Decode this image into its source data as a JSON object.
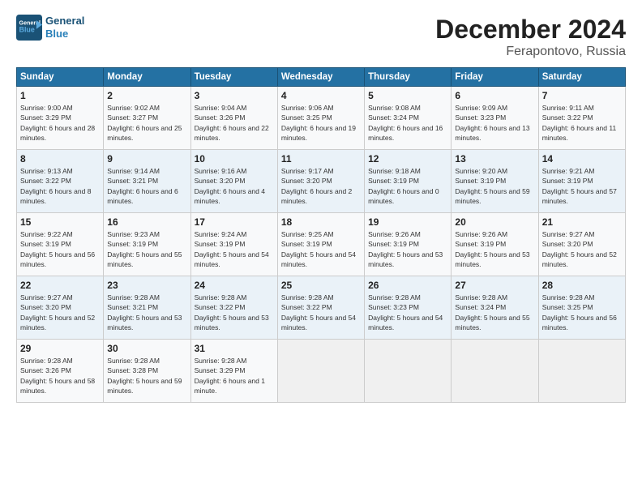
{
  "header": {
    "logo_line1": "General",
    "logo_line2": "Blue",
    "month": "December 2024",
    "location": "Ferapontovo, Russia"
  },
  "columns": [
    "Sunday",
    "Monday",
    "Tuesday",
    "Wednesday",
    "Thursday",
    "Friday",
    "Saturday"
  ],
  "weeks": [
    [
      {
        "day": "1",
        "sunrise": "Sunrise: 9:00 AM",
        "sunset": "Sunset: 3:29 PM",
        "daylight": "Daylight: 6 hours and 28 minutes."
      },
      {
        "day": "2",
        "sunrise": "Sunrise: 9:02 AM",
        "sunset": "Sunset: 3:27 PM",
        "daylight": "Daylight: 6 hours and 25 minutes."
      },
      {
        "day": "3",
        "sunrise": "Sunrise: 9:04 AM",
        "sunset": "Sunset: 3:26 PM",
        "daylight": "Daylight: 6 hours and 22 minutes."
      },
      {
        "day": "4",
        "sunrise": "Sunrise: 9:06 AM",
        "sunset": "Sunset: 3:25 PM",
        "daylight": "Daylight: 6 hours and 19 minutes."
      },
      {
        "day": "5",
        "sunrise": "Sunrise: 9:08 AM",
        "sunset": "Sunset: 3:24 PM",
        "daylight": "Daylight: 6 hours and 16 minutes."
      },
      {
        "day": "6",
        "sunrise": "Sunrise: 9:09 AM",
        "sunset": "Sunset: 3:23 PM",
        "daylight": "Daylight: 6 hours and 13 minutes."
      },
      {
        "day": "7",
        "sunrise": "Sunrise: 9:11 AM",
        "sunset": "Sunset: 3:22 PM",
        "daylight": "Daylight: 6 hours and 11 minutes."
      }
    ],
    [
      {
        "day": "8",
        "sunrise": "Sunrise: 9:13 AM",
        "sunset": "Sunset: 3:22 PM",
        "daylight": "Daylight: 6 hours and 8 minutes."
      },
      {
        "day": "9",
        "sunrise": "Sunrise: 9:14 AM",
        "sunset": "Sunset: 3:21 PM",
        "daylight": "Daylight: 6 hours and 6 minutes."
      },
      {
        "day": "10",
        "sunrise": "Sunrise: 9:16 AM",
        "sunset": "Sunset: 3:20 PM",
        "daylight": "Daylight: 6 hours and 4 minutes."
      },
      {
        "day": "11",
        "sunrise": "Sunrise: 9:17 AM",
        "sunset": "Sunset: 3:20 PM",
        "daylight": "Daylight: 6 hours and 2 minutes."
      },
      {
        "day": "12",
        "sunrise": "Sunrise: 9:18 AM",
        "sunset": "Sunset: 3:19 PM",
        "daylight": "Daylight: 6 hours and 0 minutes."
      },
      {
        "day": "13",
        "sunrise": "Sunrise: 9:20 AM",
        "sunset": "Sunset: 3:19 PM",
        "daylight": "Daylight: 5 hours and 59 minutes."
      },
      {
        "day": "14",
        "sunrise": "Sunrise: 9:21 AM",
        "sunset": "Sunset: 3:19 PM",
        "daylight": "Daylight: 5 hours and 57 minutes."
      }
    ],
    [
      {
        "day": "15",
        "sunrise": "Sunrise: 9:22 AM",
        "sunset": "Sunset: 3:19 PM",
        "daylight": "Daylight: 5 hours and 56 minutes."
      },
      {
        "day": "16",
        "sunrise": "Sunrise: 9:23 AM",
        "sunset": "Sunset: 3:19 PM",
        "daylight": "Daylight: 5 hours and 55 minutes."
      },
      {
        "day": "17",
        "sunrise": "Sunrise: 9:24 AM",
        "sunset": "Sunset: 3:19 PM",
        "daylight": "Daylight: 5 hours and 54 minutes."
      },
      {
        "day": "18",
        "sunrise": "Sunrise: 9:25 AM",
        "sunset": "Sunset: 3:19 PM",
        "daylight": "Daylight: 5 hours and 54 minutes."
      },
      {
        "day": "19",
        "sunrise": "Sunrise: 9:26 AM",
        "sunset": "Sunset: 3:19 PM",
        "daylight": "Daylight: 5 hours and 53 minutes."
      },
      {
        "day": "20",
        "sunrise": "Sunrise: 9:26 AM",
        "sunset": "Sunset: 3:19 PM",
        "daylight": "Daylight: 5 hours and 53 minutes."
      },
      {
        "day": "21",
        "sunrise": "Sunrise: 9:27 AM",
        "sunset": "Sunset: 3:20 PM",
        "daylight": "Daylight: 5 hours and 52 minutes."
      }
    ],
    [
      {
        "day": "22",
        "sunrise": "Sunrise: 9:27 AM",
        "sunset": "Sunset: 3:20 PM",
        "daylight": "Daylight: 5 hours and 52 minutes."
      },
      {
        "day": "23",
        "sunrise": "Sunrise: 9:28 AM",
        "sunset": "Sunset: 3:21 PM",
        "daylight": "Daylight: 5 hours and 53 minutes."
      },
      {
        "day": "24",
        "sunrise": "Sunrise: 9:28 AM",
        "sunset": "Sunset: 3:22 PM",
        "daylight": "Daylight: 5 hours and 53 minutes."
      },
      {
        "day": "25",
        "sunrise": "Sunrise: 9:28 AM",
        "sunset": "Sunset: 3:22 PM",
        "daylight": "Daylight: 5 hours and 54 minutes."
      },
      {
        "day": "26",
        "sunrise": "Sunrise: 9:28 AM",
        "sunset": "Sunset: 3:23 PM",
        "daylight": "Daylight: 5 hours and 54 minutes."
      },
      {
        "day": "27",
        "sunrise": "Sunrise: 9:28 AM",
        "sunset": "Sunset: 3:24 PM",
        "daylight": "Daylight: 5 hours and 55 minutes."
      },
      {
        "day": "28",
        "sunrise": "Sunrise: 9:28 AM",
        "sunset": "Sunset: 3:25 PM",
        "daylight": "Daylight: 5 hours and 56 minutes."
      }
    ],
    [
      {
        "day": "29",
        "sunrise": "Sunrise: 9:28 AM",
        "sunset": "Sunset: 3:26 PM",
        "daylight": "Daylight: 5 hours and 58 minutes."
      },
      {
        "day": "30",
        "sunrise": "Sunrise: 9:28 AM",
        "sunset": "Sunset: 3:28 PM",
        "daylight": "Daylight: 5 hours and 59 minutes."
      },
      {
        "day": "31",
        "sunrise": "Sunrise: 9:28 AM",
        "sunset": "Sunset: 3:29 PM",
        "daylight": "Daylight: 6 hours and 1 minute."
      },
      {
        "day": "",
        "sunrise": "",
        "sunset": "",
        "daylight": ""
      },
      {
        "day": "",
        "sunrise": "",
        "sunset": "",
        "daylight": ""
      },
      {
        "day": "",
        "sunrise": "",
        "sunset": "",
        "daylight": ""
      },
      {
        "day": "",
        "sunrise": "",
        "sunset": "",
        "daylight": ""
      }
    ]
  ]
}
